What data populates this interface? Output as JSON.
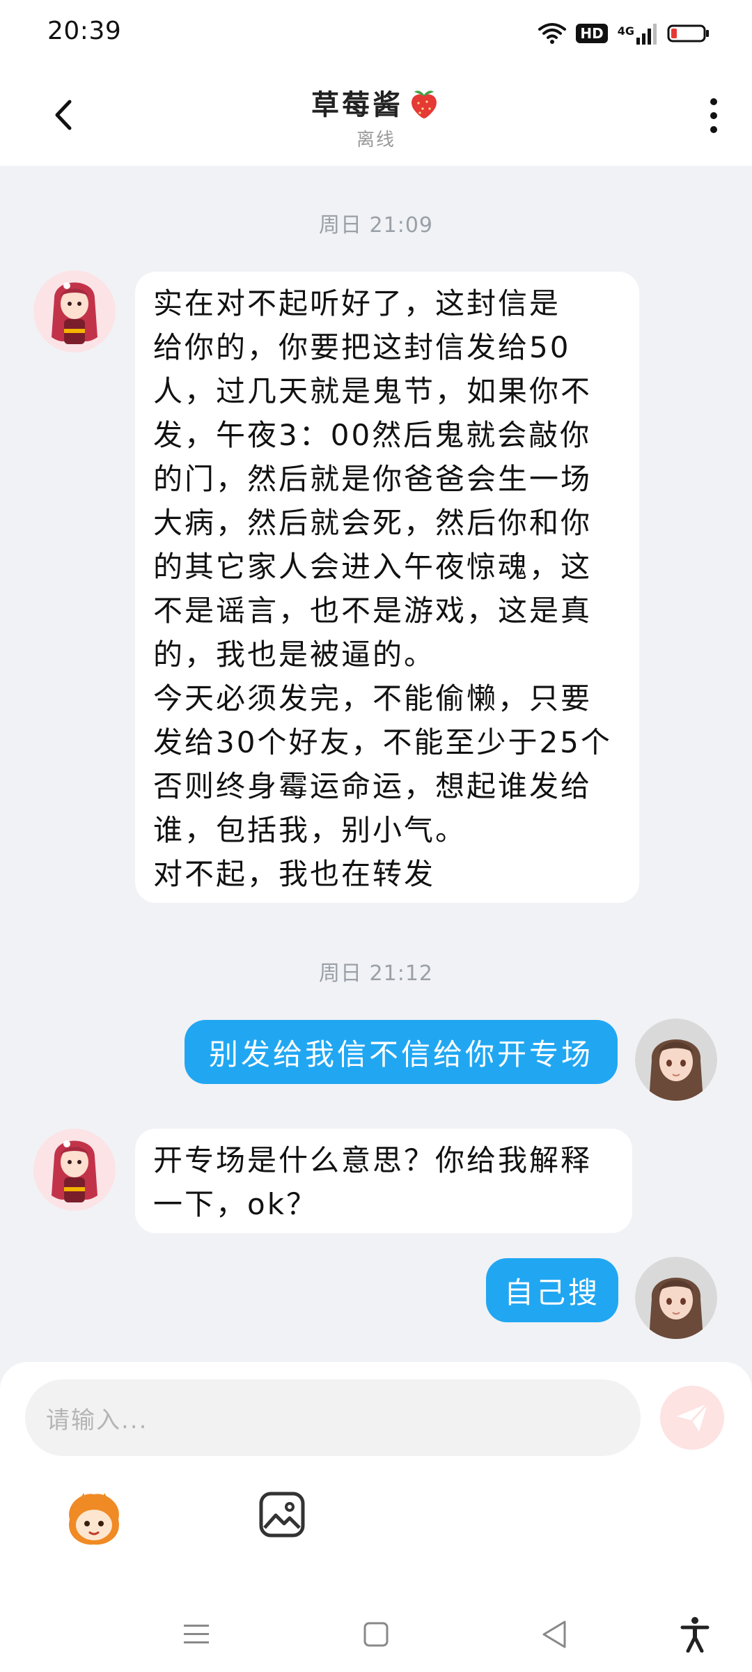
{
  "status_bar": {
    "time": "20:39",
    "hd_label": "HD",
    "network_label": "4G",
    "icons": [
      "wifi-icon",
      "signal-icon",
      "battery-icon"
    ]
  },
  "header": {
    "title": "草莓酱",
    "title_emoji": "🍓",
    "status": "离线",
    "icons": [
      "back-arrow-icon",
      "more-dots-icon"
    ]
  },
  "messages": [
    {
      "timestamp": "周日 21:09",
      "direction": "incoming",
      "lines": [
        "实在对不起听好了，这封信是",
        "给你的，你要把这封信发给50",
        "人，过几天就是鬼节，如果你不",
        "发，午夜3：00然后鬼就会敲你",
        "的门，然后就是你爸爸会生一场",
        "大病，然后就会死，然后你和你",
        "的其它家人会进入午夜惊魂，这",
        "不是谣言，也不是游戏，这是真",
        "的，我也是被逼的。",
        "今天必须发完，不能偷懒，只要",
        "发给30个好友，不能至少于25个",
        "否则终身霉运命运，想起谁发给",
        "谁，包括我，别小气。",
        "对不起，我也在转发"
      ]
    },
    {
      "timestamp": "周日 21:12",
      "direction": "outgoing",
      "text": "别发给我信不信给你开专场"
    },
    {
      "direction": "incoming",
      "lines": [
        "开专场是什么意思？你给我解释",
        "一下，ok？"
      ]
    },
    {
      "direction": "outgoing",
      "text": "自己搜"
    }
  ],
  "composer": {
    "placeholder": "请输入...",
    "tools": [
      "mascot-emoji-icon",
      "image-picker-icon"
    ],
    "send_icon": "send-icon"
  },
  "nav_bar": {
    "icons": [
      "menu-lines-icon",
      "home-square-icon",
      "back-triangle-icon",
      "accessibility-icon"
    ]
  },
  "colors": {
    "outgoing_bubble": "#21a7f2",
    "incoming_bubble": "#ffffff",
    "chat_background": "#f1f2f5",
    "send_button": "#fde3e2"
  }
}
